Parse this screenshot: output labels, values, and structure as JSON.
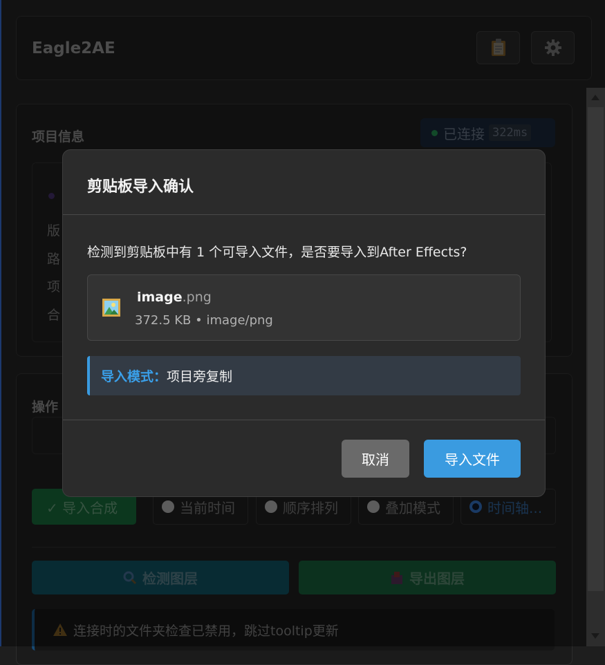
{
  "header": {
    "app_title": "Eagle2AE"
  },
  "project": {
    "title": "项目信息",
    "status": "已连接",
    "latency": "322ms",
    "labels": [
      "版",
      "路",
      "项",
      "合"
    ]
  },
  "ops": {
    "title": "操作",
    "modes": [
      "✓ 导入合成",
      "当前时间",
      "顺序排列",
      "叠加模式",
      "时间轴..."
    ],
    "detect_label": "检测图层",
    "export_label": "导出图层",
    "alert_text": "连接时的文件夹检查已禁用，跳过tooltip更新"
  },
  "dialog": {
    "title": "剪贴板导入确认",
    "message": "检测到剪贴板中有 1 个可导入文件，是否要导入到After Effects?",
    "file": {
      "base": "image",
      "ext": ".png",
      "meta": "372.5 KB • image/png"
    },
    "mode_label": "导入模式：",
    "mode_value": "项目旁复制",
    "cancel_label": "取消",
    "import_label": "导入文件"
  },
  "colors": {
    "accent": "#3a9be0",
    "success": "#155c33",
    "info": "#0e4956"
  }
}
